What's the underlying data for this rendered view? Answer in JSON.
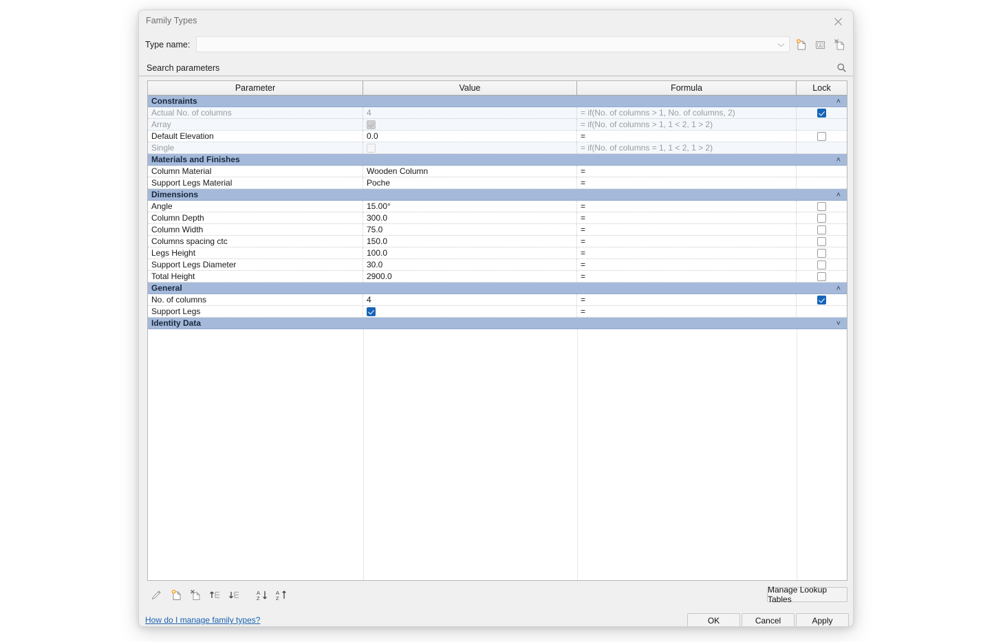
{
  "window": {
    "title": "Family Types",
    "close_icon": "close-icon"
  },
  "type_name": {
    "label": "Type name:",
    "value": "",
    "placeholder": "",
    "dropdown_icon": "chevron-down-icon",
    "actions": [
      {
        "name": "new-type",
        "title": "New Type"
      },
      {
        "name": "rename-type",
        "title": "Rename"
      },
      {
        "name": "delete-type",
        "title": "Delete Type"
      }
    ]
  },
  "search": {
    "placeholder": "Search parameters",
    "value": "",
    "icon": "search-icon"
  },
  "grid": {
    "columns": [
      "Parameter",
      "Value",
      "Formula",
      "Lock"
    ],
    "groups": [
      {
        "name": "Constraints",
        "collapsed": false,
        "chevron": "˄",
        "rows": [
          {
            "parameter": "Actual No. of columns",
            "dimmed": true,
            "value": "4",
            "value_type": "text",
            "formula": "= if(No. of columns > 1, No. of columns, 2)",
            "lock": "checked"
          },
          {
            "parameter": "Array",
            "dimmed": true,
            "value": "",
            "value_type": "checkbox-disabled-checked",
            "formula": "= if(No. of columns > 1, 1 < 2, 1 > 2)",
            "lock": "none"
          },
          {
            "parameter": "Default Elevation",
            "dimmed": false,
            "value": "0.0",
            "value_type": "text",
            "formula": "=",
            "lock": "unchecked"
          },
          {
            "parameter": "Single",
            "dimmed": true,
            "value": "",
            "value_type": "checkbox-disabled-unchecked",
            "formula": "= if(No. of columns = 1, 1 < 2, 1 > 2)",
            "lock": "none"
          }
        ]
      },
      {
        "name": "Materials and Finishes",
        "collapsed": false,
        "chevron": "˄",
        "rows": [
          {
            "parameter": "Column Material",
            "dimmed": false,
            "value": "Wooden Column",
            "value_type": "text",
            "formula": "=",
            "lock": "none"
          },
          {
            "parameter": "Support Legs Material",
            "dimmed": false,
            "value": "Poche",
            "value_type": "text",
            "formula": "=",
            "lock": "none"
          }
        ]
      },
      {
        "name": "Dimensions",
        "collapsed": false,
        "chevron": "˄",
        "rows": [
          {
            "parameter": "Angle",
            "dimmed": false,
            "value": "15.00°",
            "value_type": "text",
            "formula": "=",
            "lock": "unchecked"
          },
          {
            "parameter": "Column Depth",
            "dimmed": false,
            "value": "300.0",
            "value_type": "text",
            "formula": "=",
            "lock": "unchecked"
          },
          {
            "parameter": "Column Width",
            "dimmed": false,
            "value": "75.0",
            "value_type": "text",
            "formula": "=",
            "lock": "unchecked"
          },
          {
            "parameter": "Columns spacing ctc",
            "dimmed": false,
            "value": "150.0",
            "value_type": "text",
            "formula": "=",
            "lock": "unchecked"
          },
          {
            "parameter": "Legs Height",
            "dimmed": false,
            "value": "100.0",
            "value_type": "text",
            "formula": "=",
            "lock": "unchecked"
          },
          {
            "parameter": "Support Legs Diameter",
            "dimmed": false,
            "value": "30.0",
            "value_type": "text",
            "formula": "=",
            "lock": "unchecked"
          },
          {
            "parameter": "Total Height",
            "dimmed": false,
            "value": "2900.0",
            "value_type": "text",
            "formula": "=",
            "lock": "unchecked"
          }
        ]
      },
      {
        "name": "General",
        "collapsed": false,
        "chevron": "˄",
        "rows": [
          {
            "parameter": "No. of columns",
            "dimmed": false,
            "value": "4",
            "value_type": "text",
            "formula": "=",
            "lock": "checked"
          },
          {
            "parameter": "Support Legs",
            "dimmed": false,
            "value": "",
            "value_type": "checkbox-checked",
            "formula": "=",
            "lock": "none"
          }
        ]
      },
      {
        "name": "Identity Data",
        "collapsed": true,
        "chevron": "˅",
        "rows": []
      }
    ]
  },
  "toolbar": {
    "icons": [
      {
        "name": "edit-parameter-icon",
        "title": "Modify"
      },
      {
        "name": "new-parameter-icon",
        "title": "New Parameter"
      },
      {
        "name": "remove-parameter-icon",
        "title": "Remove Parameter"
      },
      {
        "name": "move-up-icon",
        "title": "Move Up"
      },
      {
        "name": "move-down-icon",
        "title": "Move Down"
      },
      {
        "name": "sort-ascending-icon",
        "title": "Sort Ascending"
      },
      {
        "name": "sort-descending-icon",
        "title": "Sort Descending"
      }
    ],
    "lookup_tables_label": "Manage Lookup Tables"
  },
  "footer": {
    "help_link": "How do I manage family types?",
    "ok_label": "OK",
    "cancel_label": "Cancel",
    "apply_label": "Apply"
  },
  "colors": {
    "group_header": "#a5bada",
    "checkbox_on": "#1764b8",
    "link": "#1a62b0",
    "dialog_bg": "#f0f0f0"
  }
}
